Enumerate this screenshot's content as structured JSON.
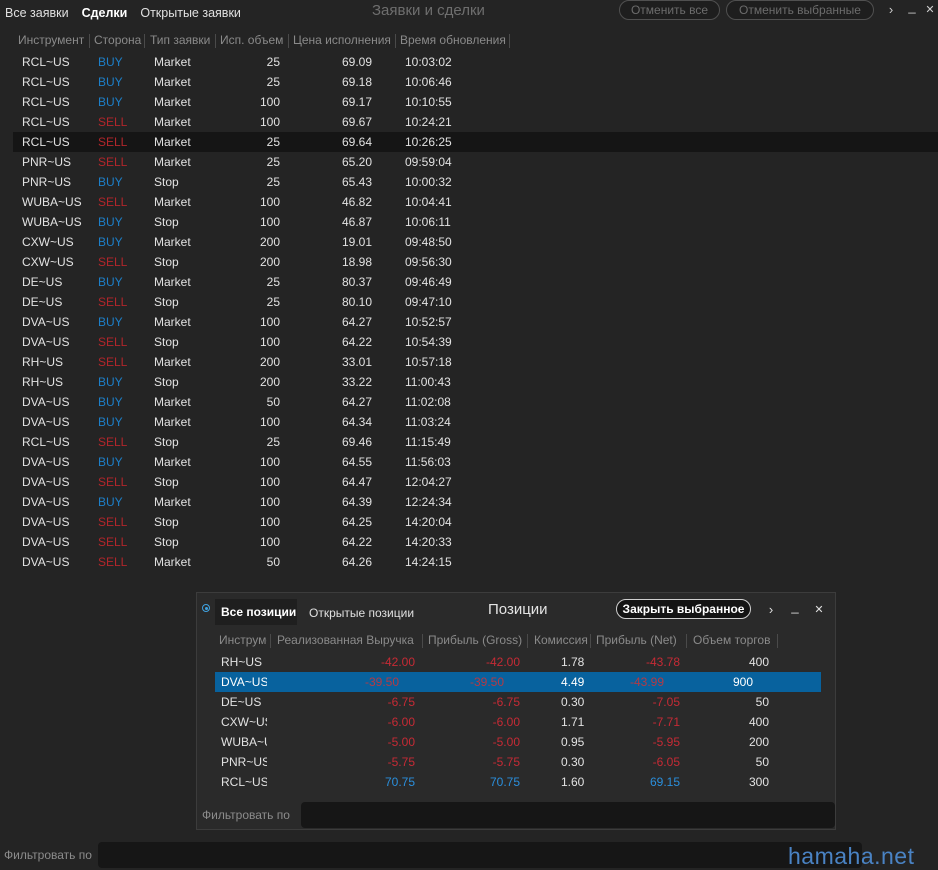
{
  "header": {
    "tabs": [
      "Все заявки",
      "Сделки",
      "Открытые заявки"
    ],
    "active_tab": "Сделки",
    "title": "Заявки и сделки",
    "cancel_all": "Отменить все",
    "cancel_selected": "Отменить выбранные",
    "more_glyph": "›",
    "minimize_glyph": "_",
    "close_glyph": "✕"
  },
  "orders": {
    "columns": [
      "Инструмент",
      "Сторона",
      "Тип заявки",
      "Исп. объем",
      "Цена исполнения",
      "Время обновления"
    ],
    "selected_row": 4,
    "rows": [
      {
        "inst": "RCL~US",
        "side": "BUY",
        "type": "Market",
        "qty": "25",
        "price": "69.09",
        "time": "10:03:02"
      },
      {
        "inst": "RCL~US",
        "side": "BUY",
        "type": "Market",
        "qty": "25",
        "price": "69.18",
        "time": "10:06:46"
      },
      {
        "inst": "RCL~US",
        "side": "BUY",
        "type": "Market",
        "qty": "100",
        "price": "69.17",
        "time": "10:10:55"
      },
      {
        "inst": "RCL~US",
        "side": "SELL",
        "type": "Market",
        "qty": "100",
        "price": "69.67",
        "time": "10:24:21"
      },
      {
        "inst": "RCL~US",
        "side": "SELL",
        "type": "Market",
        "qty": "25",
        "price": "69.64",
        "time": "10:26:25"
      },
      {
        "inst": "PNR~US",
        "side": "SELL",
        "type": "Market",
        "qty": "25",
        "price": "65.20",
        "time": "09:59:04"
      },
      {
        "inst": "PNR~US",
        "side": "BUY",
        "type": "Stop",
        "qty": "25",
        "price": "65.43",
        "time": "10:00:32"
      },
      {
        "inst": "WUBA~US",
        "side": "SELL",
        "type": "Market",
        "qty": "100",
        "price": "46.82",
        "time": "10:04:41"
      },
      {
        "inst": "WUBA~US",
        "side": "BUY",
        "type": "Stop",
        "qty": "100",
        "price": "46.87",
        "time": "10:06:11"
      },
      {
        "inst": "CXW~US",
        "side": "BUY",
        "type": "Market",
        "qty": "200",
        "price": "19.01",
        "time": "09:48:50"
      },
      {
        "inst": "CXW~US",
        "side": "SELL",
        "type": "Stop",
        "qty": "200",
        "price": "18.98",
        "time": "09:56:30"
      },
      {
        "inst": "DE~US",
        "side": "BUY",
        "type": "Market",
        "qty": "25",
        "price": "80.37",
        "time": "09:46:49"
      },
      {
        "inst": "DE~US",
        "side": "SELL",
        "type": "Stop",
        "qty": "25",
        "price": "80.10",
        "time": "09:47:10"
      },
      {
        "inst": "DVA~US",
        "side": "BUY",
        "type": "Market",
        "qty": "100",
        "price": "64.27",
        "time": "10:52:57"
      },
      {
        "inst": "DVA~US",
        "side": "SELL",
        "type": "Stop",
        "qty": "100",
        "price": "64.22",
        "time": "10:54:39"
      },
      {
        "inst": "RH~US",
        "side": "SELL",
        "type": "Market",
        "qty": "200",
        "price": "33.01",
        "time": "10:57:18"
      },
      {
        "inst": "RH~US",
        "side": "BUY",
        "type": "Stop",
        "qty": "200",
        "price": "33.22",
        "time": "11:00:43"
      },
      {
        "inst": "DVA~US",
        "side": "BUY",
        "type": "Market",
        "qty": "50",
        "price": "64.27",
        "time": "11:02:08"
      },
      {
        "inst": "DVA~US",
        "side": "BUY",
        "type": "Market",
        "qty": "100",
        "price": "64.34",
        "time": "11:03:24"
      },
      {
        "inst": "RCL~US",
        "side": "SELL",
        "type": "Stop",
        "qty": "25",
        "price": "69.46",
        "time": "11:15:49"
      },
      {
        "inst": "DVA~US",
        "side": "BUY",
        "type": "Market",
        "qty": "100",
        "price": "64.55",
        "time": "11:56:03"
      },
      {
        "inst": "DVA~US",
        "side": "SELL",
        "type": "Stop",
        "qty": "100",
        "price": "64.47",
        "time": "12:04:27"
      },
      {
        "inst": "DVA~US",
        "side": "BUY",
        "type": "Market",
        "qty": "100",
        "price": "64.39",
        "time": "12:24:34"
      },
      {
        "inst": "DVA~US",
        "side": "SELL",
        "type": "Stop",
        "qty": "100",
        "price": "64.25",
        "time": "14:20:04"
      },
      {
        "inst": "DVA~US",
        "side": "SELL",
        "type": "Stop",
        "qty": "100",
        "price": "64.22",
        "time": "14:20:33"
      },
      {
        "inst": "DVA~US",
        "side": "SELL",
        "type": "Market",
        "qty": "50",
        "price": "64.26",
        "time": "14:24:15"
      }
    ]
  },
  "positions": {
    "tabs": [
      "Все позиции",
      "Открытые позиции"
    ],
    "active_tab": "Все позиции",
    "title": "Позиции",
    "close_selected": "Закрыть выбранное",
    "columns": [
      "Инструмент",
      "Реализованная Выручка",
      "Прибыль (Gross)",
      "Комиссия",
      "Прибыль (Net)",
      "Объем торгов"
    ],
    "selected_row": 1,
    "rows": [
      {
        "inst": "RH~US",
        "rev": "-42.00",
        "gross": "-42.00",
        "comm": "1.78",
        "net": "-43.78",
        "vol": "400"
      },
      {
        "inst": "DVA~US",
        "rev": "-39.50",
        "gross": "-39.50",
        "comm": "4.49",
        "net": "-43.99",
        "vol": "900"
      },
      {
        "inst": "DE~US",
        "rev": "-6.75",
        "gross": "-6.75",
        "comm": "0.30",
        "net": "-7.05",
        "vol": "50"
      },
      {
        "inst": "CXW~US",
        "rev": "-6.00",
        "gross": "-6.00",
        "comm": "1.71",
        "net": "-7.71",
        "vol": "400"
      },
      {
        "inst": "WUBA~US",
        "rev": "-5.00",
        "gross": "-5.00",
        "comm": "0.95",
        "net": "-5.95",
        "vol": "200"
      },
      {
        "inst": "PNR~US",
        "rev": "-5.75",
        "gross": "-5.75",
        "comm": "0.30",
        "net": "-6.05",
        "vol": "50"
      },
      {
        "inst": "RCL~US",
        "rev": "70.75",
        "gross": "70.75",
        "comm": "1.60",
        "net": "69.15",
        "vol": "300"
      }
    ],
    "filter_label": "Фильтровать по"
  },
  "bottom": {
    "filter_label": "Фильтровать по",
    "watermark": "hamaha.net"
  },
  "colors": {
    "buy": "#1d7fc8",
    "sell": "#b3262b",
    "selected_position": "#08629e",
    "positive": "#2a8fdc",
    "negative": "#c62a35"
  }
}
